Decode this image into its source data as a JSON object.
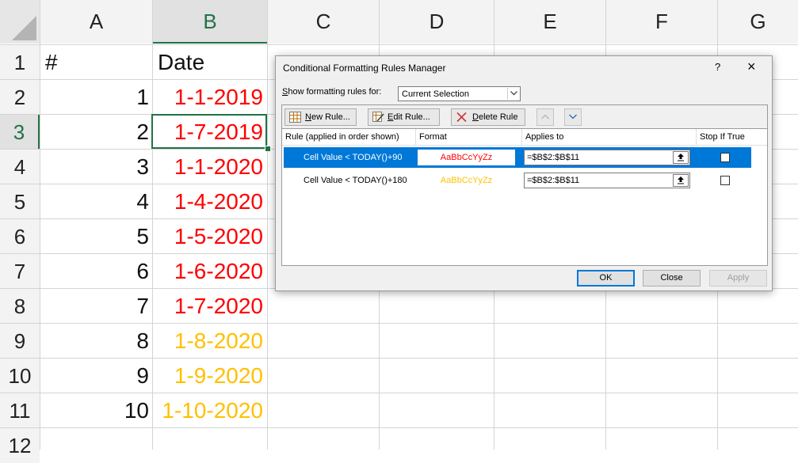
{
  "sheet": {
    "columns": [
      "A",
      "B",
      "C",
      "D",
      "E",
      "F",
      "G"
    ],
    "selected_column": "B",
    "rows": [
      "1",
      "2",
      "3",
      "4",
      "5",
      "6",
      "7",
      "8",
      "9",
      "10",
      "11",
      "12"
    ],
    "selected_row": "3",
    "header_row": {
      "a": "#",
      "b": "Date"
    },
    "data_rows": [
      {
        "num": "1",
        "date": "1-1-2019",
        "color": "#ff0000"
      },
      {
        "num": "2",
        "date": "1-7-2019",
        "color": "#ff0000"
      },
      {
        "num": "3",
        "date": "1-1-2020",
        "color": "#ff0000"
      },
      {
        "num": "4",
        "date": "1-4-2020",
        "color": "#ff0000"
      },
      {
        "num": "5",
        "date": "1-5-2020",
        "color": "#ff0000"
      },
      {
        "num": "6",
        "date": "1-6-2020",
        "color": "#ff0000"
      },
      {
        "num": "7",
        "date": "1-7-2020",
        "color": "#ff0000"
      },
      {
        "num": "8",
        "date": "1-8-2020",
        "color": "#ffc000"
      },
      {
        "num": "9",
        "date": "1-9-2020",
        "color": "#ffc000"
      },
      {
        "num": "10",
        "date": "1-10-2020",
        "color": "#ffc000"
      }
    ]
  },
  "dialog": {
    "title": "Conditional Formatting Rules Manager",
    "help": "?",
    "close": "×",
    "show_rules_label_prefix": "S",
    "show_rules_label_rest": "how formatting rules for:",
    "show_rules_value": "Current Selection",
    "toolbar": {
      "new_rule_acc": "N",
      "new_rule_rest": "ew Rule...",
      "edit_rule_acc": "E",
      "edit_rule_rest": "dit Rule...",
      "delete_rule_acc": "D",
      "delete_rule_rest": "elete Rule",
      "move_up_icon": "chevron-up-icon",
      "move_down_icon": "chevron-down-icon"
    },
    "columns": {
      "rule": "Rule (applied in order shown)",
      "format": "Format",
      "applies_to": "Applies to",
      "stop_if_true": "Stop If True"
    },
    "rules": [
      {
        "rule": "Cell Value < TODAY()+90",
        "format_preview": "AaBbCcYyZz",
        "format_color": "#ff0000",
        "applies_to": "=$B$2:$B$11",
        "stop_if_true": false,
        "selected": true
      },
      {
        "rule": "Cell Value < TODAY()+180",
        "format_preview": "AaBbCcYyZz",
        "format_color": "#ffc000",
        "applies_to": "=$B$2:$B$11",
        "stop_if_true": false,
        "selected": false
      }
    ],
    "buttons": {
      "ok": "OK",
      "close": "Close",
      "apply": "Apply"
    },
    "accent_color": "#0078d7"
  }
}
